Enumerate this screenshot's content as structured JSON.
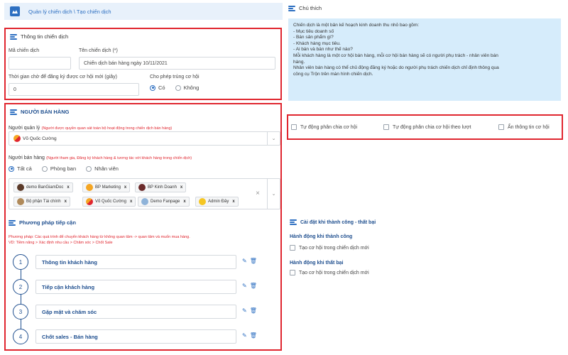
{
  "breadcrumb": {
    "text": "Quản lý chiến dịch \\ Tạo chiến dịch"
  },
  "campaign_info": {
    "section_title": "Thông tin chiến dịch",
    "code_label": "Mã chiến dịch",
    "code_value": "",
    "name_label": "Tên chiến dịch (*)",
    "name_value": "Chiến dịch bán hàng ngày 10/11/2021",
    "wait_label": "Thời gian chờ để đăng ký được cơ hội mới (giây)",
    "wait_value": "0",
    "allow_label": "Cho phép trùng cơ hội",
    "allow_yes": "Có",
    "allow_no": "Không"
  },
  "sellers": {
    "section_title": "NGƯỜI BÁN HÀNG",
    "manager_label": "Người quản lý",
    "manager_hint": "(Người được quyền quan sát toàn bộ hoạt động trong chiến dịch bán hàng)",
    "manager_value": "Võ Quốc Cường",
    "seller_label": "Người bán hàng",
    "seller_hint": "(Người tham gia, Đăng ký khách hàng & tương tác với khách hàng trong chiến dịch)",
    "radio_all": "Tất cả",
    "radio_dept": "Phòng ban",
    "radio_staff": "Nhân viên",
    "tags": [
      "demo BanGiamDoc",
      "BP Marketing",
      "BP Kinh Doanh",
      "Bộ phận Tài chính",
      "Võ Quốc Cường",
      "Demo Fanpage",
      "Admin Đây"
    ],
    "tag_remove": "x",
    "clear": "×",
    "dropdown": "⌄"
  },
  "approach": {
    "section_title": "Phương pháp tiếp cận",
    "desc_line1": "Phương pháp: Các quá trình để chuyển khách hàng từ không quan tâm -> quan tâm và muốn mua hàng.",
    "desc_line2": "VD: Tiềm năng > Xác định nhu cầu > Chăm sóc > Chốt Sale",
    "steps": [
      {
        "num": "1",
        "label": "Thông tin khách hàng"
      },
      {
        "num": "2",
        "label": "Tiếp cận khách hàng"
      },
      {
        "num": "3",
        "label": "Gặp mặt và chăm sóc"
      },
      {
        "num": "4",
        "label": "Chốt sales - Bán hàng"
      }
    ]
  },
  "note": {
    "title": "Chú thích",
    "lines": [
      "Chiến dịch là một bản kế hoạch kinh doanh thu nhỏ bao gồm:",
      "- Mục tiêu doanh số",
      "- Bán sản phẩm gì?",
      "- Khách hàng mục tiêu.",
      "- Ai bán và bán như thế nào?",
      "Mỗi khách hàng là một cơ hội bán hàng, mỗi cơ hội bán hàng sẽ có người phụ trách - nhân viên bán",
      "hàng.",
      "Nhân viên bán hàng có thể chủ động đăng ký hoặc do người phụ trách chiến dịch chỉ định thông qua",
      "công cụ Trộn trên màn hình chiến dịch."
    ]
  },
  "options": {
    "auto_split": "Tự động phân chia cơ hội",
    "auto_split_turn": "Tự động phân chia cơ hội theo lượt",
    "hide_info": "Ẩn thông tin cơ hội"
  },
  "result_settings": {
    "title": "Cài đặt khi thành công - thất bại",
    "success_title": "Hành động khi thành công",
    "success_option": "Tạo cơ hội trong chiến dịch mới",
    "fail_title": "Hành động khi thất bại",
    "fail_option": "Tạo cơ hội trong chiến dịch mới"
  },
  "colors": {
    "accent": "#2d6fc1",
    "highlight_border": "#e0262f",
    "note_bg": "#d6ecfb"
  }
}
